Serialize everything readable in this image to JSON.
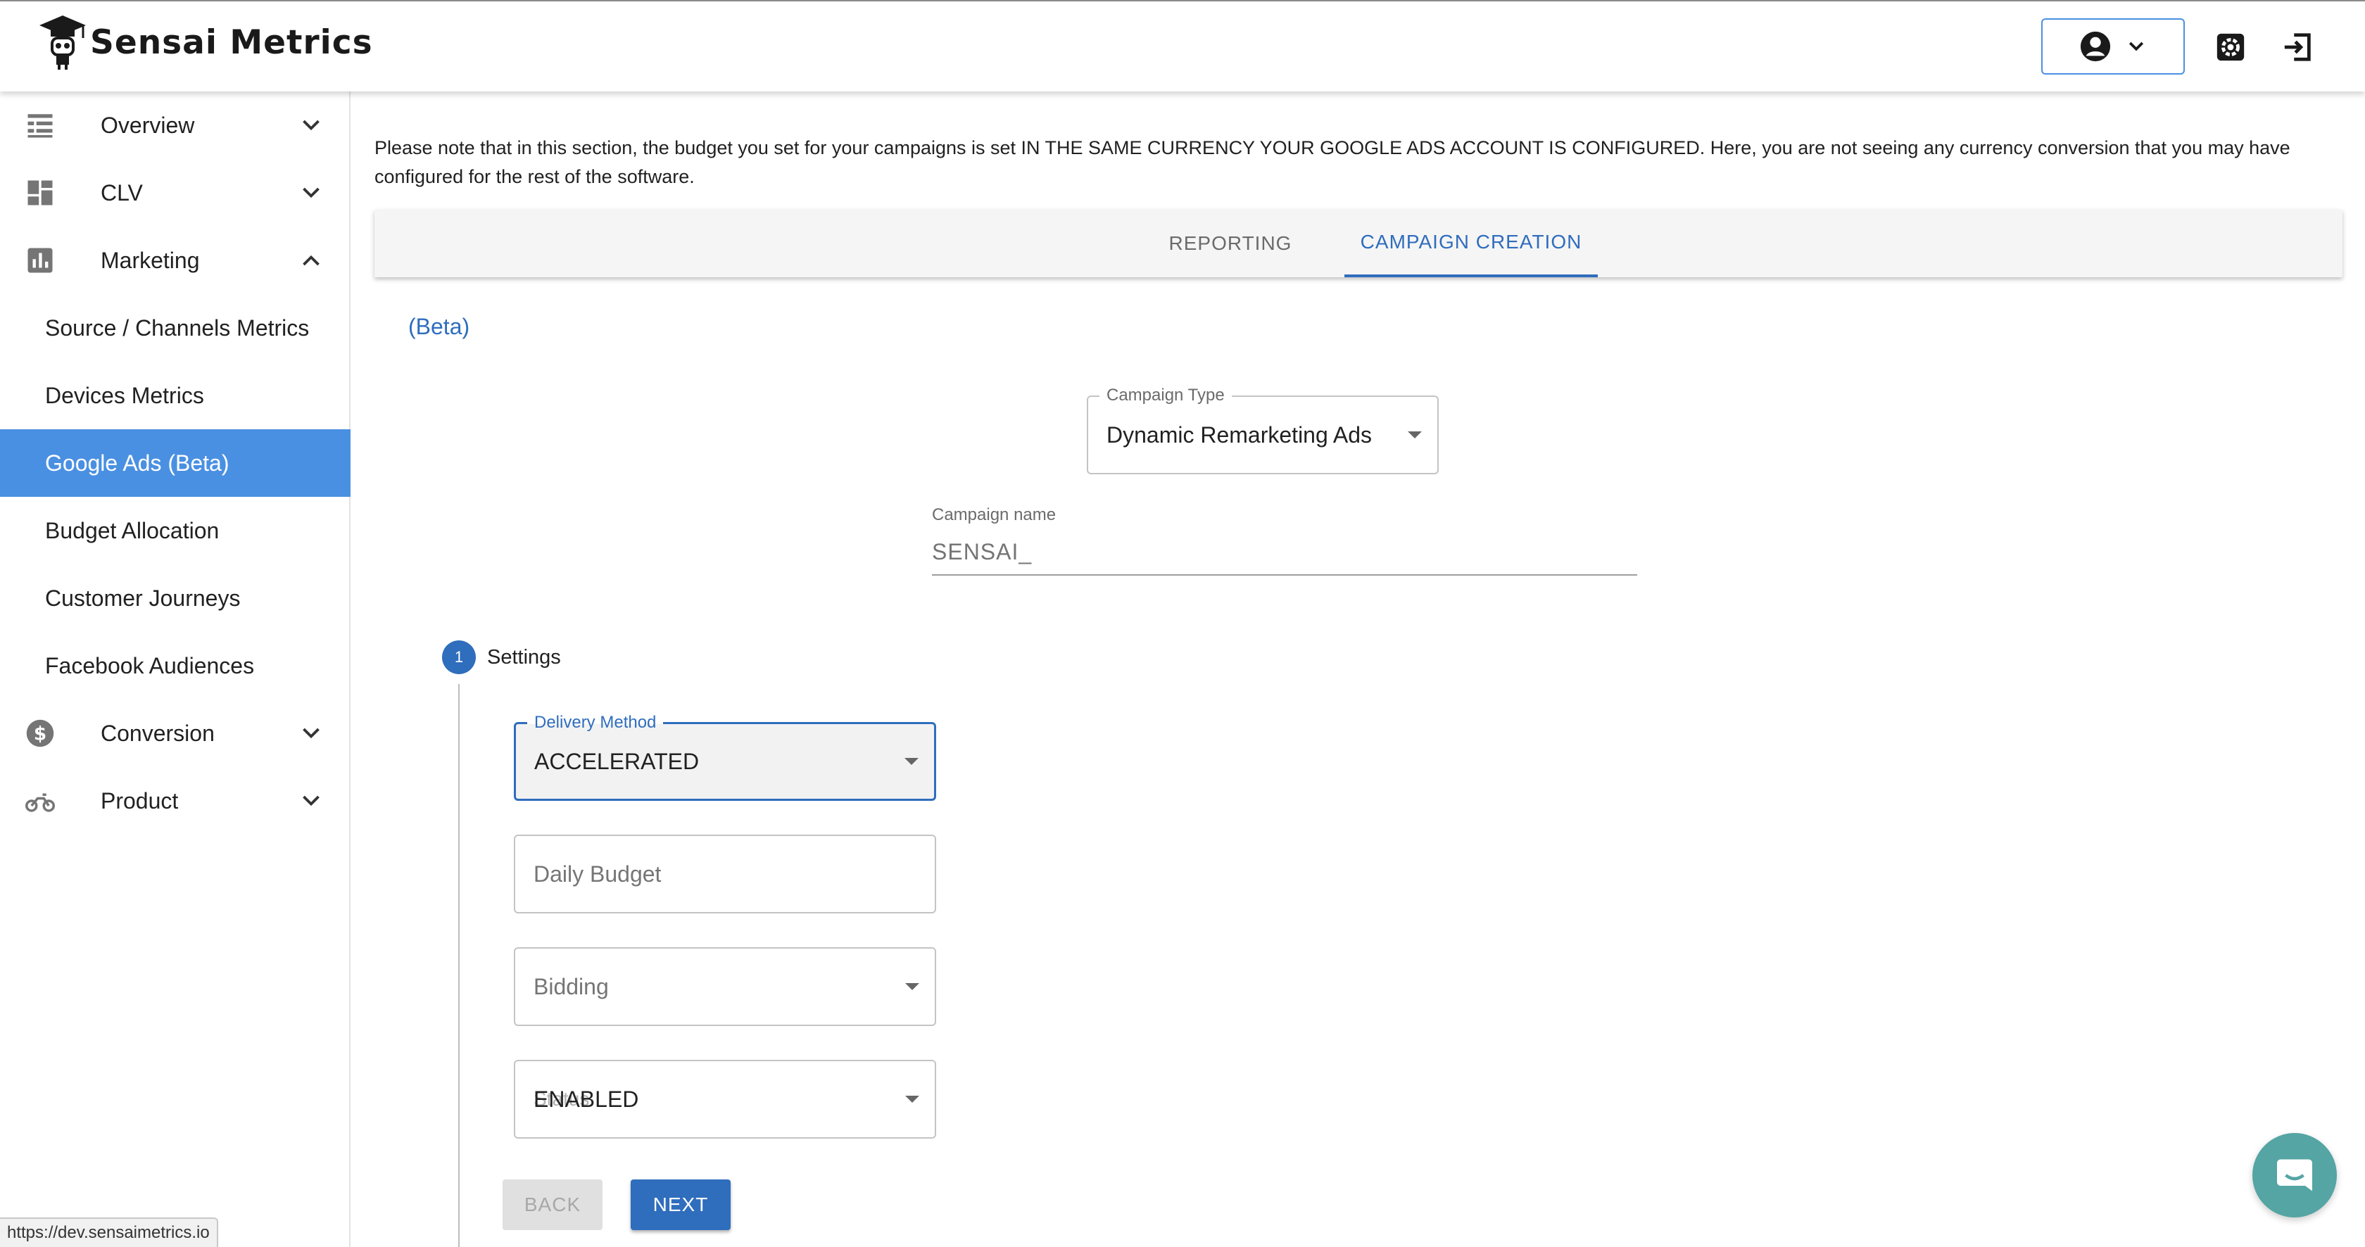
{
  "header": {
    "app_name": "Sensai Metrics"
  },
  "sidebar": {
    "sections": [
      {
        "label": "Overview",
        "icon": "table-icon",
        "expanded": false
      },
      {
        "label": "CLV",
        "icon": "dashboard-icon",
        "expanded": false
      },
      {
        "label": "Marketing",
        "icon": "bar-chart-icon",
        "expanded": true
      },
      {
        "label": "Conversion",
        "icon": "dollar-icon",
        "expanded": false
      },
      {
        "label": "Product",
        "icon": "motorcycle-icon",
        "expanded": false
      }
    ],
    "marketing_items": [
      {
        "label": "Source / Channels Metrics",
        "active": false
      },
      {
        "label": "Devices Metrics",
        "active": false
      },
      {
        "label": "Google Ads (Beta)",
        "active": true
      },
      {
        "label": "Budget Allocation",
        "active": false
      },
      {
        "label": "Customer Journeys",
        "active": false
      },
      {
        "label": "Facebook Audiences",
        "active": false
      }
    ]
  },
  "main": {
    "notice": "Please note that in this section, the budget you set for your campaigns is set IN THE SAME CURRENCY YOUR GOOGLE ADS ACCOUNT IS CONFIGURED. Here, you are not seeing any currency conversion that you may have configured for the rest of the software.",
    "tabs": [
      {
        "label": "REPORTING",
        "active": false
      },
      {
        "label": "CAMPAIGN CREATION",
        "active": true
      }
    ],
    "beta_label": "(Beta)",
    "campaign_type": {
      "label": "Campaign Type",
      "value": "Dynamic Remarketing Ads"
    },
    "campaign_name": {
      "label": "Campaign name",
      "value": "SENSAI_"
    },
    "step": {
      "number": "1",
      "label": "Settings"
    },
    "delivery_method": {
      "label": "Delivery Method",
      "value": "ACCELERATED"
    },
    "daily_budget": {
      "placeholder": "Daily Budget"
    },
    "bidding": {
      "placeholder": "Bidding"
    },
    "status": {
      "value": "ENABLED",
      "overlap_placeholder": "Status"
    },
    "buttons": {
      "back": "BACK",
      "next": "NEXT"
    }
  },
  "status_bar": {
    "url": "https://dev.sensaimetrics.io"
  },
  "colors": {
    "accent": "#2f6dbd",
    "active_nav": "#4a90e2",
    "chat": "#54a5a3"
  }
}
